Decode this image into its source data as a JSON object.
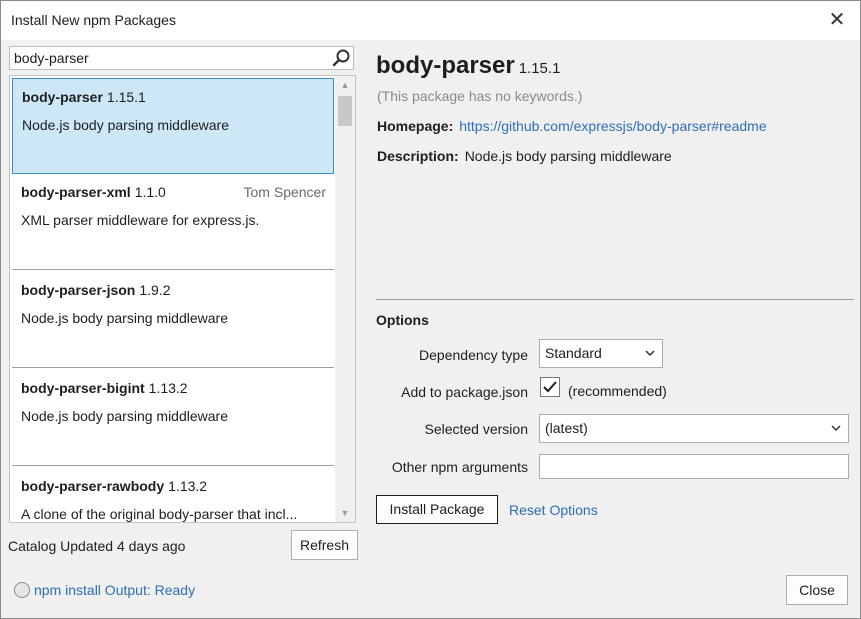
{
  "window": {
    "title": "Install New npm Packages",
    "close_glyph": "✕"
  },
  "search": {
    "value": "body-parser",
    "icon": "search-icon"
  },
  "packages": [
    {
      "name": "body-parser",
      "version": "1.15.1",
      "author": "",
      "description": "Node.js body parsing middleware",
      "selected": true
    },
    {
      "name": "body-parser-xml",
      "version": "1.1.0",
      "author": "Tom Spencer",
      "description": "XML parser middleware for express.js."
    },
    {
      "name": "body-parser-json",
      "version": "1.9.2",
      "author": "",
      "description": "Node.js body parsing middleware"
    },
    {
      "name": "body-parser-bigint",
      "version": "1.13.2",
      "author": "",
      "description": "Node.js body parsing middleware"
    },
    {
      "name": "body-parser-rawbody",
      "version": "1.13.2",
      "author": "",
      "description": "A clone of the original body-parser that incl..."
    }
  ],
  "catalog": {
    "status": "Catalog Updated 4 days ago",
    "refresh_label": "Refresh"
  },
  "details": {
    "name": "body-parser",
    "version": "1.15.1",
    "keywords": "(This package has no keywords.)",
    "homepage_label": "Homepage:",
    "homepage_url": "https://github.com/expressjs/body-parser#readme",
    "description_label": "Description:",
    "description": "Node.js body parsing middleware"
  },
  "options": {
    "heading": "Options",
    "dependency_type_label": "Dependency type",
    "dependency_type_value": "Standard",
    "add_to_package_label": "Add to package.json",
    "add_to_package_checked": true,
    "add_to_package_note": "(recommended)",
    "selected_version_label": "Selected version",
    "selected_version_value": "(latest)",
    "other_args_label": "Other npm arguments",
    "other_args_value": "",
    "install_label": "Install Package",
    "reset_label": "Reset Options"
  },
  "footer": {
    "status_text": "npm install Output: Ready",
    "close_label": "Close"
  },
  "colors": {
    "selection_bg": "#cce8f7",
    "selection_border": "#3a8fc7",
    "link": "#2e6eb5",
    "panel_bg": "#f0f0f0"
  }
}
